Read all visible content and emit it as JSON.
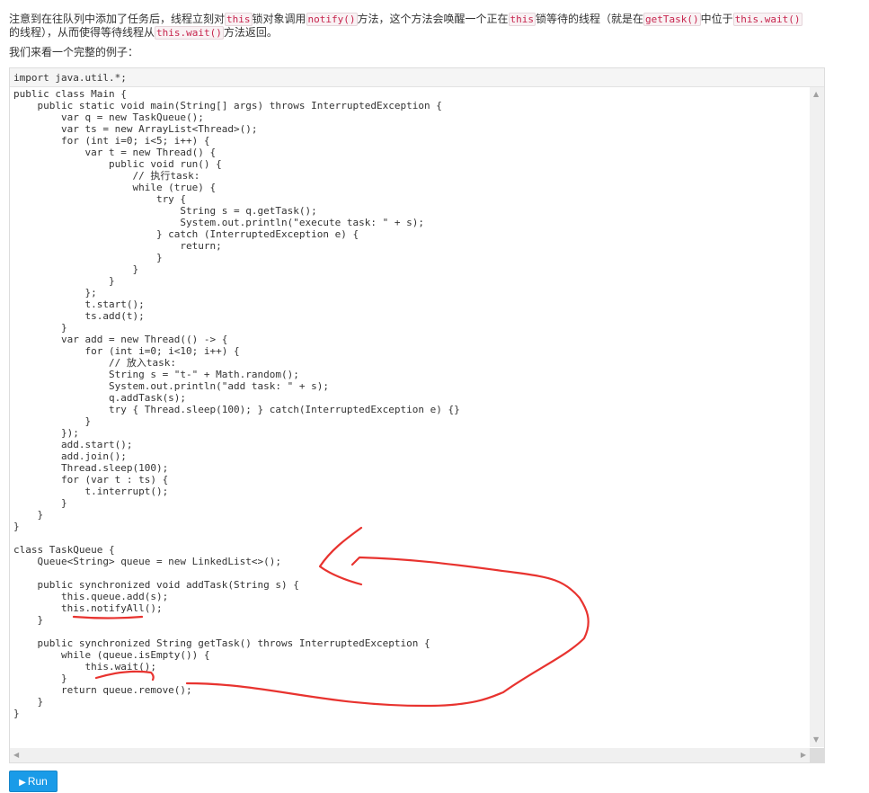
{
  "intro": {
    "t1": "注意到在往队列中添加了任务后，线程立刻对",
    "c1": "this",
    "t2": "锁对象调用",
    "c2": "notify()",
    "t3": "方法，这个方法会唤醒一个正在",
    "c3": "this",
    "t4": "锁等待的线程（就是在",
    "c4": "getTask()",
    "t5": "中位于",
    "c5": "this.wait()",
    "t6": "的线程），从而使得等待线程从",
    "c6": "this.wait()",
    "t7": "方法返回。"
  },
  "example_label": "我们来看一个完整的例子：",
  "editor": {
    "import_line": "import java.util.*;",
    "code": "public class Main {\n    public static void main(String[] args) throws InterruptedException {\n        var q = new TaskQueue();\n        var ts = new ArrayList<Thread>();\n        for (int i=0; i<5; i++) {\n            var t = new Thread() {\n                public void run() {\n                    // 执行task:\n                    while (true) {\n                        try {\n                            String s = q.getTask();\n                            System.out.println(\"execute task: \" + s);\n                        } catch (InterruptedException e) {\n                            return;\n                        }\n                    }\n                }\n            };\n            t.start();\n            ts.add(t);\n        }\n        var add = new Thread(() -> {\n            for (int i=0; i<10; i++) {\n                // 放入task:\n                String s = \"t-\" + Math.random();\n                System.out.println(\"add task: \" + s);\n                q.addTask(s);\n                try { Thread.sleep(100); } catch(InterruptedException e) {}\n            }\n        });\n        add.start();\n        add.join();\n        Thread.sleep(100);\n        for (var t : ts) {\n            t.interrupt();\n        }\n    }\n}\n\nclass TaskQueue {\n    Queue<String> queue = new LinkedList<>();\n\n    public synchronized void addTask(String s) {\n        this.queue.add(s);\n        this.notifyAll();\n    }\n\n    public synchronized String getTask() throws InterruptedException {\n        while (queue.isEmpty()) {\n            this.wait();\n        }\n        return queue.remove();\n    }\n}"
  },
  "run_button": {
    "icon": "play-icon",
    "label": "Run"
  },
  "colors": {
    "annotation": "#e8332f",
    "run_button": "#1a9be8",
    "inline_code": "#c7254e"
  }
}
